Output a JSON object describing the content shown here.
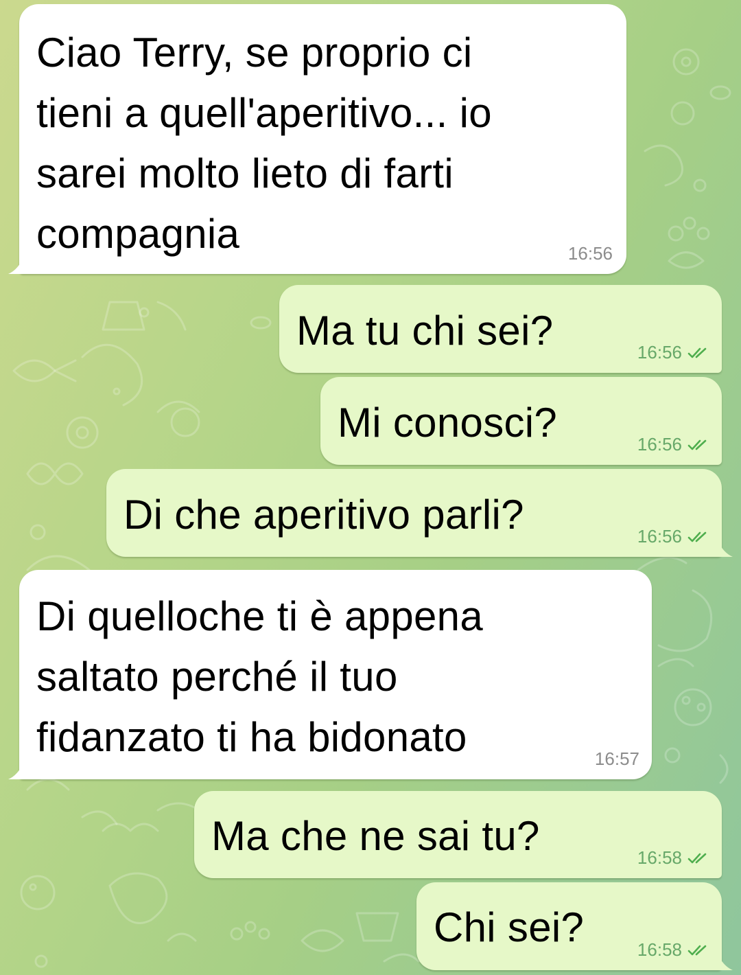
{
  "chat": {
    "background_color": "#b5d589",
    "incoming_bubble_color": "#ffffff",
    "outgoing_bubble_color": "#e6f8c8",
    "read_tick_color": "#4fae4e",
    "messages": [
      {
        "direction": "incoming",
        "lines": [
          "Ciao Terry, se proprio ci",
          "tieni a quell'aperitivo... io",
          "sarei molto lieto di farti",
          "compagnia"
        ],
        "time": "16:56"
      },
      {
        "direction": "outgoing",
        "lines": [
          "Ma tu chi sei?"
        ],
        "time": "16:56",
        "status": "read"
      },
      {
        "direction": "outgoing",
        "lines": [
          "Mi conosci?"
        ],
        "time": "16:56",
        "status": "read"
      },
      {
        "direction": "outgoing",
        "lines": [
          "Di che aperitivo parli?"
        ],
        "time": "16:56",
        "status": "read"
      },
      {
        "direction": "incoming",
        "lines": [
          "Di quelloche ti è appena",
          "saltato perché il tuo",
          "fidanzato ti ha bidonato"
        ],
        "time": "16:57"
      },
      {
        "direction": "outgoing",
        "lines": [
          "Ma che ne sai tu?"
        ],
        "time": "16:58",
        "status": "read"
      },
      {
        "direction": "outgoing",
        "lines": [
          "Chi sei?"
        ],
        "time": "16:58",
        "status": "read"
      }
    ]
  }
}
